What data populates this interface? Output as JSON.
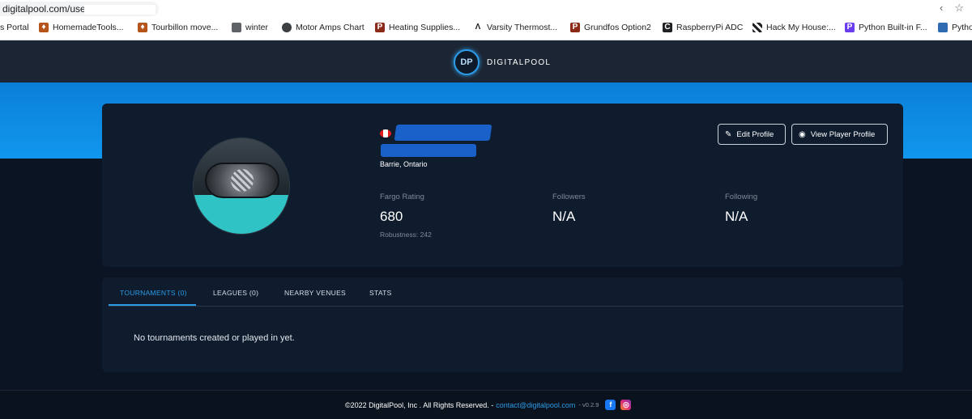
{
  "browser": {
    "url": "digitalpool.com/use",
    "share_icon": "share-icon",
    "star_icon": "star-icon",
    "bookmarks": [
      {
        "label": "s Portal",
        "icon": ""
      },
      {
        "label": "HomemadeTools...",
        "icon": "cooking-icon"
      },
      {
        "label": "Tourbillon move...",
        "icon": "cooking-icon"
      },
      {
        "label": "winter",
        "icon": "folder-icon"
      },
      {
        "label": "Motor Amps Chart",
        "icon": "globe-icon"
      },
      {
        "label": "Heating Supplies...",
        "icon": "p-box-icon"
      },
      {
        "label": "Varsity Thermost...",
        "icon": "caret-icon"
      },
      {
        "label": "Grundfos Option2",
        "icon": "p-box-icon"
      },
      {
        "label": "RaspberryPi ADC",
        "icon": "c-icon"
      },
      {
        "label": "Hack My House:...",
        "icon": "checker-icon"
      },
      {
        "label": "Python Built-in F...",
        "icon": "p-arrow-icon"
      },
      {
        "label": "Pytho",
        "icon": "python-icon"
      }
    ]
  },
  "header": {
    "logo_mark": "DP",
    "logo_text": "DIGITALPOOL"
  },
  "profile": {
    "location": "Barrie, Ontario",
    "edit_label": "Edit Profile",
    "view_label": "View Player Profile",
    "stats": [
      {
        "label": "Fargo Rating",
        "value": "680",
        "sub": "Robustness: 242"
      },
      {
        "label": "Followers",
        "value": "N/A",
        "sub": ""
      },
      {
        "label": "Following",
        "value": "N/A",
        "sub": ""
      }
    ]
  },
  "tabs": [
    {
      "label": "TOURNAMENTS (0)",
      "active": true
    },
    {
      "label": "LEAGUES (0)",
      "active": false
    },
    {
      "label": "NEARBY VENUES",
      "active": false
    },
    {
      "label": "STATS",
      "active": false
    }
  ],
  "empty_message": "No tournaments created or played in yet.",
  "footer": {
    "copyright": "©2022 DigitalPool, Inc . All Rights Reserved. -",
    "email": "contact@digitalpool.com",
    "version": "- v0.2.9"
  },
  "colors": {
    "accent": "#2d9be6",
    "hero": "#1197ee",
    "card": "#0f1c2e",
    "background": "#0b1422"
  }
}
